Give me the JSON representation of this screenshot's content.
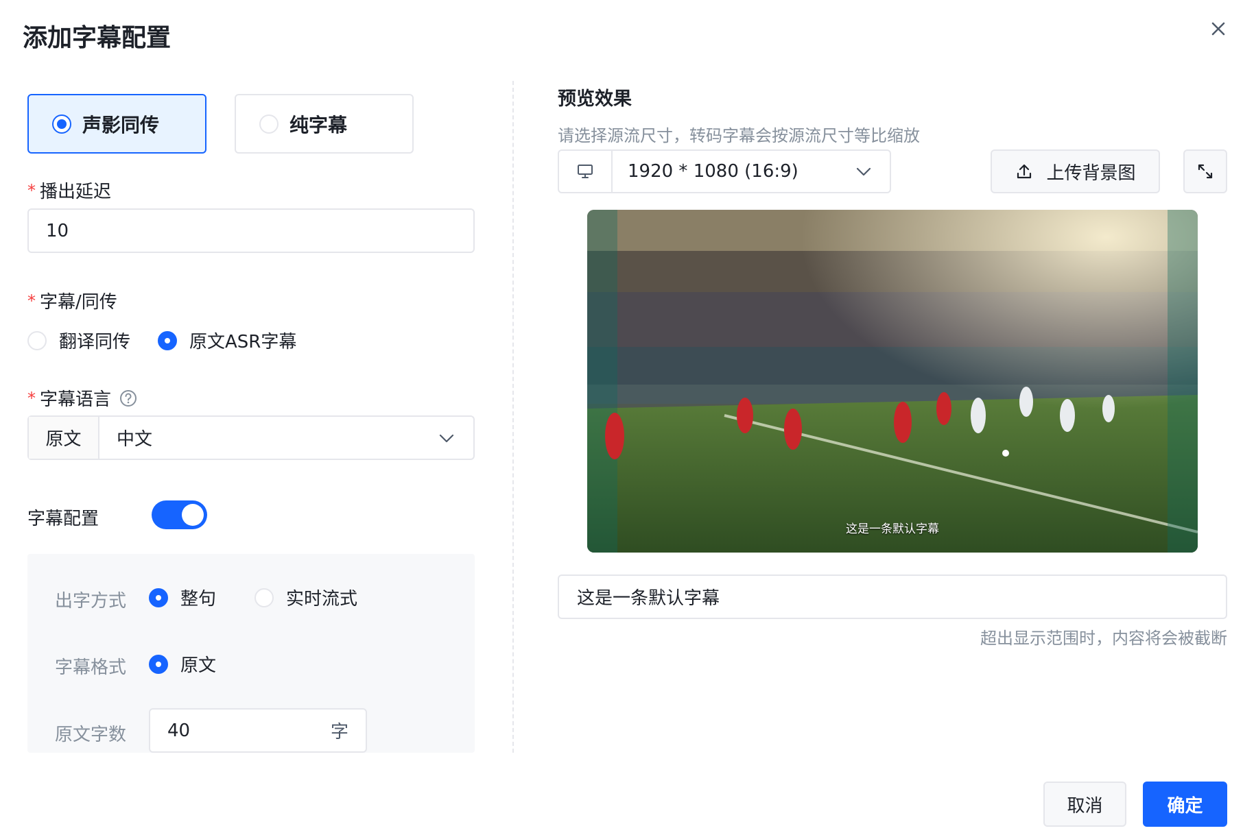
{
  "dialog": {
    "title": "添加字幕配置"
  },
  "mode_tabs": [
    {
      "label": "声影同传",
      "selected": true
    },
    {
      "label": "纯字幕",
      "selected": false
    }
  ],
  "delay": {
    "label": "播出延迟",
    "value": "10"
  },
  "subtitle_type": {
    "label": "字幕/同传",
    "options": [
      {
        "label": "翻译同传",
        "selected": false
      },
      {
        "label": "原文ASR字幕",
        "selected": true
      }
    ]
  },
  "language": {
    "label": "字幕语言",
    "prefix": "原文",
    "value": "中文"
  },
  "subtitle_config": {
    "label": "字幕配置",
    "enabled": true,
    "output_mode": {
      "label": "出字方式",
      "options": [
        {
          "label": "整句",
          "selected": true
        },
        {
          "label": "实时流式",
          "selected": false
        }
      ]
    },
    "format": {
      "label": "字幕格式",
      "options": [
        {
          "label": "原文",
          "selected": true
        }
      ]
    },
    "char_count": {
      "label": "原文字数",
      "value": "40",
      "suffix": "字"
    }
  },
  "preview": {
    "title": "预览效果",
    "hint": "请选择源流尺寸，转码字幕会按源流尺寸等比缩放",
    "resolution": "1920 * 1080 (16:9)",
    "upload_label": "上传背景图",
    "caption": "这是一条默认字幕",
    "caption_input": "这是一条默认字幕",
    "truncate_hint": "超出显示范围时，内容将会被截断"
  },
  "footer": {
    "cancel_label": "取消",
    "confirm_label": "确定"
  },
  "colors": {
    "primary": "#1664ff",
    "required": "#f53f3f",
    "border": "#e5e6eb",
    "muted_text": "#86909c"
  }
}
